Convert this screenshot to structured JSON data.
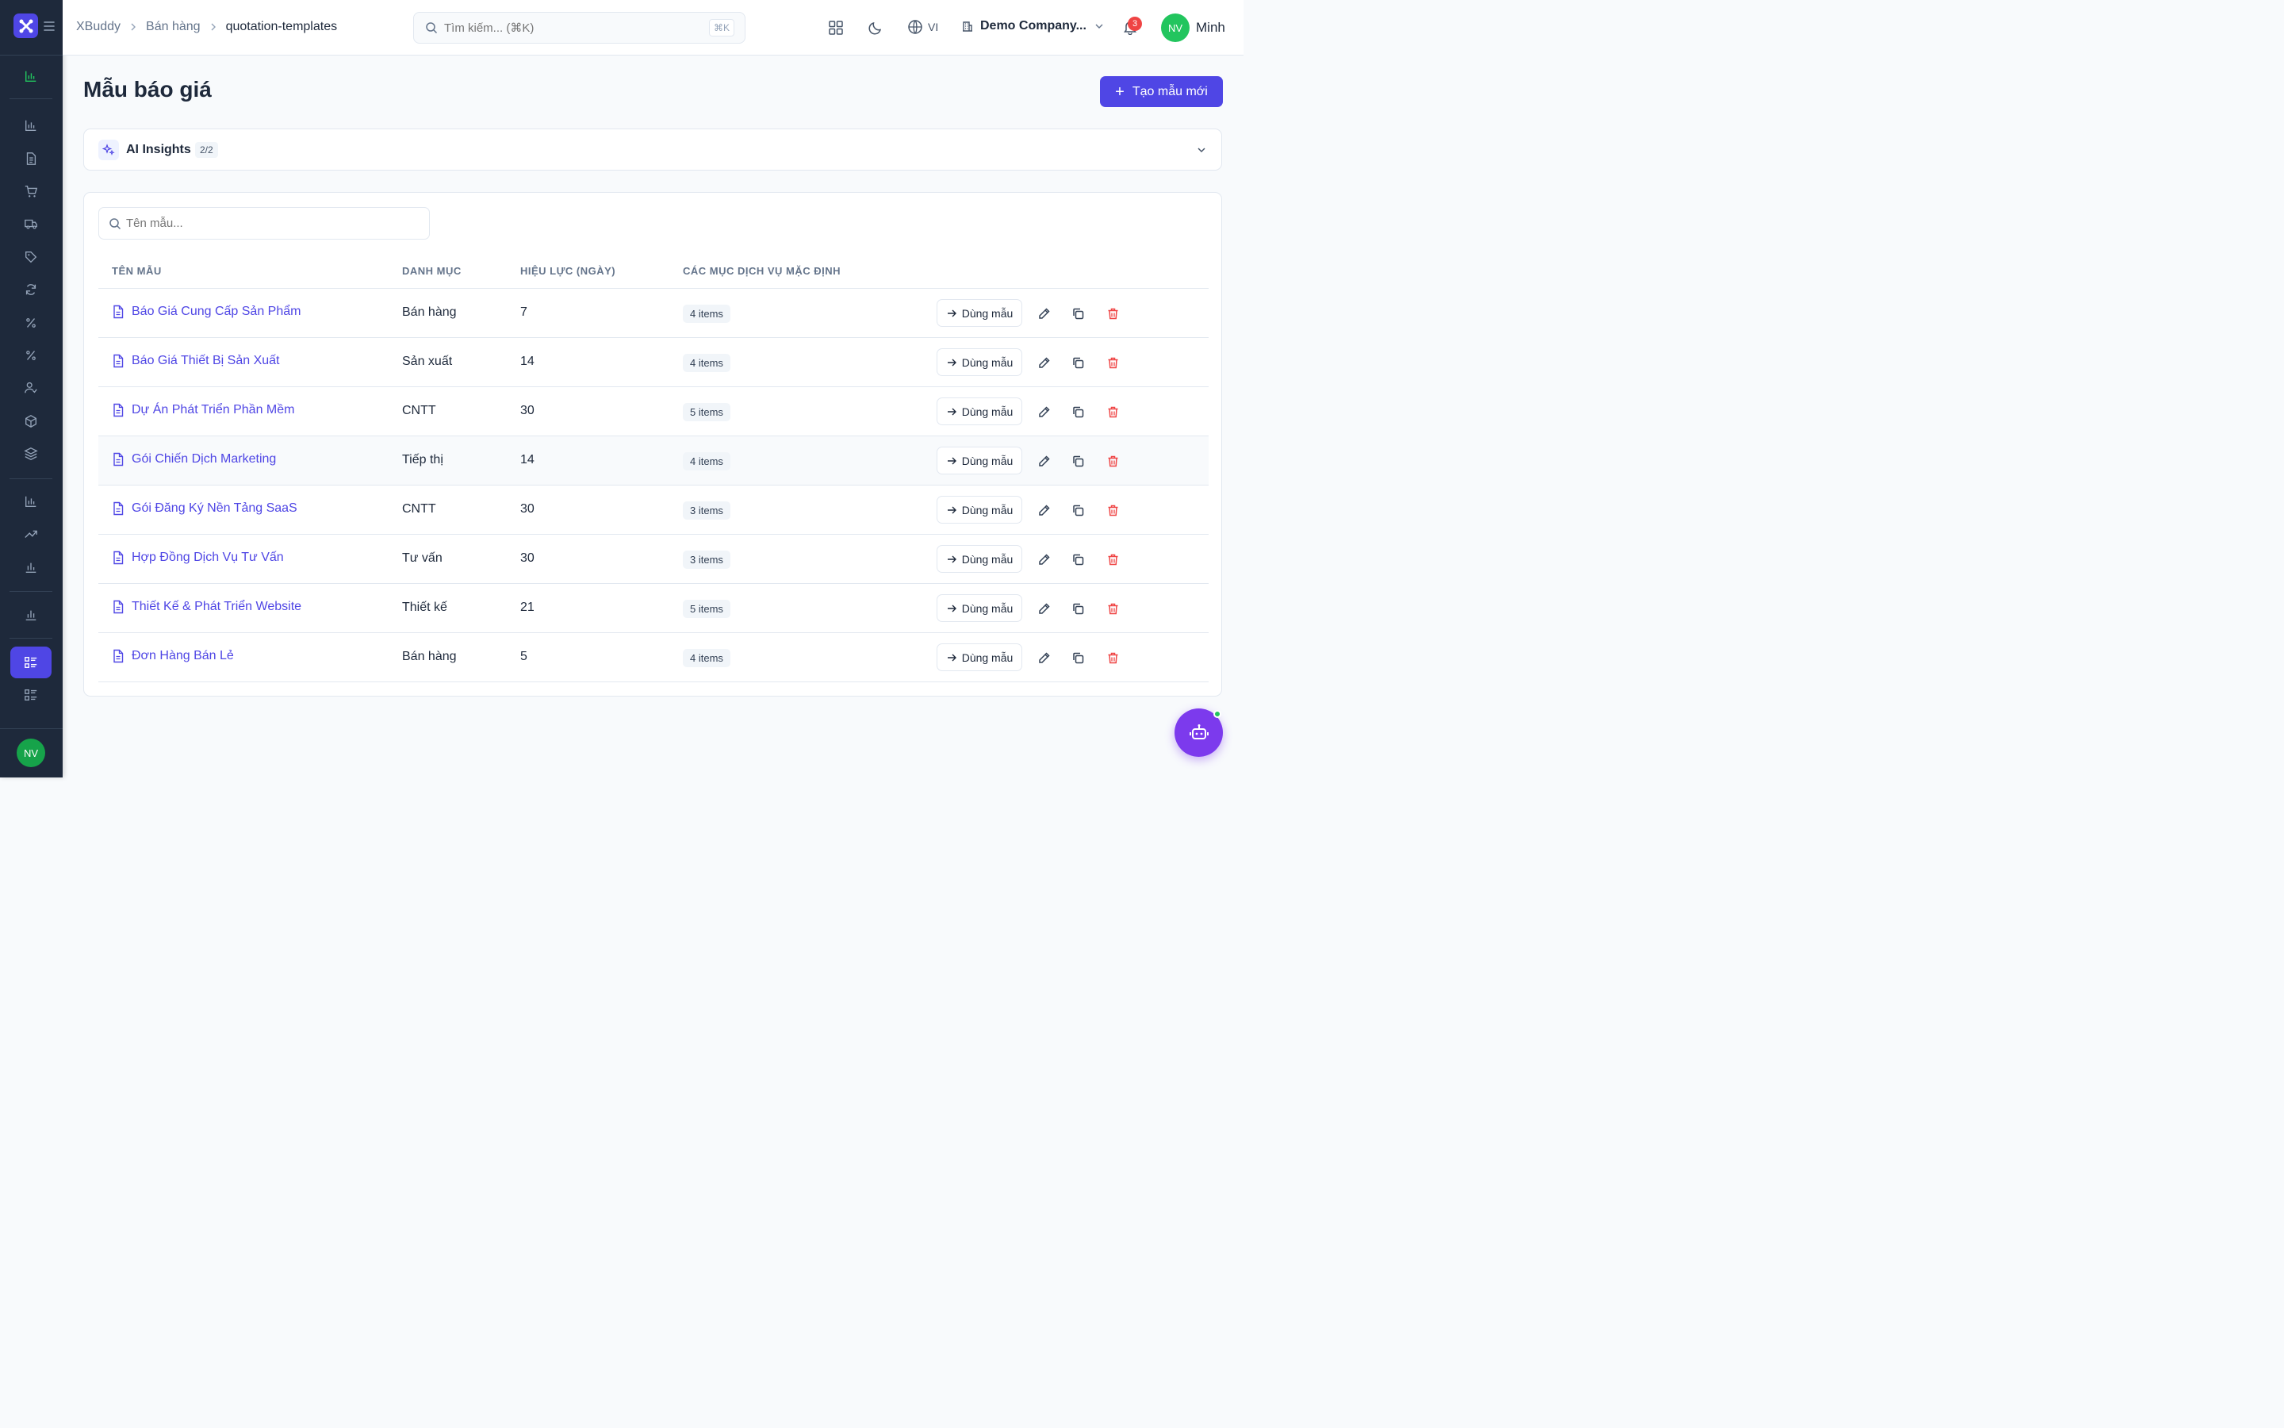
{
  "sidebar": {
    "user_initials": "NV"
  },
  "header": {
    "breadcrumb": [
      "XBuddy",
      "Bán hàng",
      "quotation-templates"
    ],
    "search_placeholder": "Tìm kiếm... (⌘K)",
    "search_shortcut": "⌘K",
    "language": "VI",
    "company": "Demo Company...",
    "notification_count": "3",
    "user_initials": "NV",
    "user_name": "Minh"
  },
  "page": {
    "title": "Mẫu báo giá",
    "create_button": "Tạo mẫu mới"
  },
  "ai_insights": {
    "title": "AI Insights",
    "count": "2/2"
  },
  "table": {
    "search_placeholder": "Tên mẫu...",
    "columns": [
      "TÊN MẪU",
      "DANH MỤC",
      "HIỆU LỰC (NGÀY)",
      "CÁC MỤC DỊCH VỤ MẶC ĐỊNH"
    ],
    "use_label": "Dùng mẫu",
    "rows": [
      {
        "name": "Báo Giá Cung Cấp Sản Phẩm",
        "category": "Bán hàng",
        "days": "7",
        "items": "4 items"
      },
      {
        "name": "Báo Giá Thiết Bị Sản Xuất",
        "category": "Sản xuất",
        "days": "14",
        "items": "4 items"
      },
      {
        "name": "Dự Án Phát Triển Phần Mềm",
        "category": "CNTT",
        "days": "30",
        "items": "5 items"
      },
      {
        "name": "Gói Chiến Dịch Marketing",
        "category": "Tiếp thị",
        "days": "14",
        "items": "4 items"
      },
      {
        "name": "Gói Đăng Ký Nền Tảng SaaS",
        "category": "CNTT",
        "days": "30",
        "items": "3 items"
      },
      {
        "name": "Hợp Đồng Dịch Vụ Tư Vấn",
        "category": "Tư vấn",
        "days": "30",
        "items": "3 items"
      },
      {
        "name": "Thiết Kế & Phát Triển Website",
        "category": "Thiết kế",
        "days": "21",
        "items": "5 items"
      },
      {
        "name": "Đơn Hàng Bán Lẻ",
        "category": "Bán hàng",
        "days": "5",
        "items": "4 items"
      }
    ]
  },
  "colors": {
    "accent": "#4f46e5",
    "sidebar_bg": "#1e293b",
    "active_green": "#22c55e",
    "danger": "#ef4444",
    "bot": "#7c3aed"
  }
}
